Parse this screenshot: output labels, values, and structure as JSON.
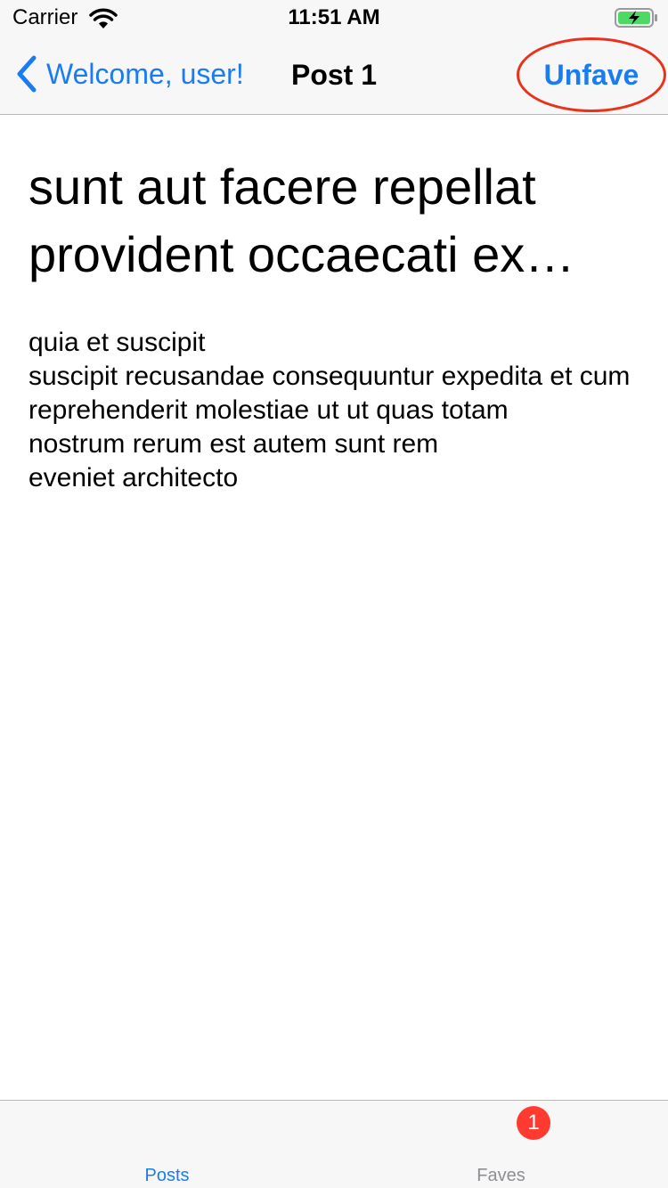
{
  "status_bar": {
    "carrier": "Carrier",
    "time": "11:51 AM",
    "icons": [
      "wifi-icon",
      "battery-charging-icon"
    ],
    "battery_color": "#4cd964"
  },
  "nav_bar": {
    "back_label": "Welcome, user!",
    "title": "Post 1",
    "action_label": "Unfave",
    "accent_color": "#1a7cf3",
    "highlight_color": "#e8321c"
  },
  "post": {
    "title": "sunt aut facere repellat provident occaecati ex…",
    "body": "quia et suscipit\nsuscipit recusandae consequuntur expedita et cum\nreprehenderit molestiae ut ut quas totam\nnostrum rerum est autem sunt rem\neveniet architecto"
  },
  "tab_bar": {
    "tabs": [
      {
        "label": "Posts",
        "selected": true
      },
      {
        "label": "Faves",
        "selected": false,
        "badge": "1"
      }
    ],
    "badge_color": "#ff3b30"
  }
}
